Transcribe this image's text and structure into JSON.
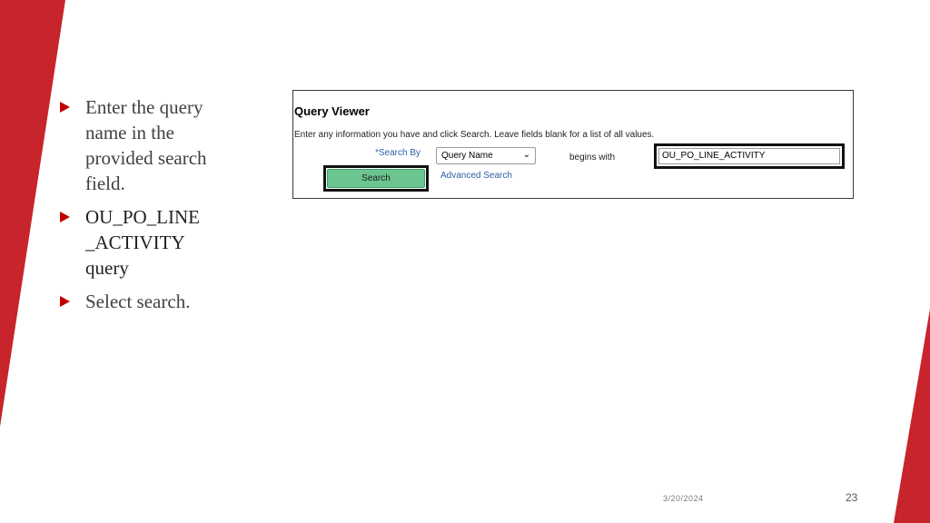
{
  "theme": {
    "accent": "#c8242b",
    "button_green": "#6cc591",
    "link_blue": "#2f5fa8"
  },
  "bullets": [
    {
      "text": "Enter the query name in the provided search field."
    },
    {
      "text": "OU_PO_LINE _ACTIVITY query"
    },
    {
      "text": "Select search."
    }
  ],
  "query_viewer": {
    "title": "Query Viewer",
    "instructions": "Enter any information you have and click Search. Leave fields blank for a list of all values.",
    "search_by_label": "*Search By",
    "search_by_selected": "Query Name",
    "begins_with_label": "begins with",
    "search_value": "OU_PO_LINE_ACTIVITY",
    "search_button": "Search",
    "advanced_search_link": "Advanced Search"
  },
  "footer": {
    "date": "3/20/2024",
    "page_number": "23"
  }
}
